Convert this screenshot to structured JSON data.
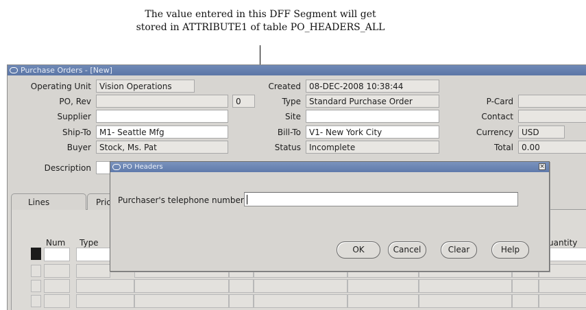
{
  "annotation": {
    "line1": "The value entered in this DFF Segment will get",
    "line2": "stored in ATTRIBUTE1 of table PO_HEADERS_ALL"
  },
  "window": {
    "title": "Purchase Orders - [New]"
  },
  "header": {
    "operating_unit_label": "Operating Unit",
    "operating_unit_value": "Vision Operations",
    "po_rev_label": "PO, Rev",
    "po_value": "",
    "rev_value": "0",
    "supplier_label": "Supplier",
    "supplier_value": "",
    "ship_to_label": "Ship-To",
    "ship_to_value": "M1- Seattle Mfg",
    "buyer_label": "Buyer",
    "buyer_value": "Stock, Ms. Pat",
    "description_label": "Description",
    "description_value": "",
    "created_label": "Created",
    "created_value": "08-DEC-2008 10:38:44",
    "type_label": "Type",
    "type_value": "Standard Purchase Order",
    "site_label": "Site",
    "site_value": "",
    "bill_to_label": "Bill-To",
    "bill_to_value": "V1- New York City",
    "status_label": "Status",
    "status_value": "Incomplete",
    "pcard_label": "P-Card",
    "pcard_value": "",
    "contact_label": "Contact",
    "contact_value": "",
    "currency_label": "Currency",
    "currency_value": "USD",
    "total_label": "Total",
    "total_value": "0.00"
  },
  "tabs": [
    {
      "label": "Lines"
    },
    {
      "label": "Pric"
    }
  ],
  "lines_table": {
    "columns": {
      "num": "Num",
      "type": "Type",
      "quantity": "uantity"
    }
  },
  "dialog": {
    "title": "PO Headers",
    "field_label": "Purchaser's telephone number",
    "field_value": "",
    "buttons": {
      "ok": "OK",
      "cancel": "Cancel",
      "clear": "Clear",
      "help": "Help"
    }
  }
}
